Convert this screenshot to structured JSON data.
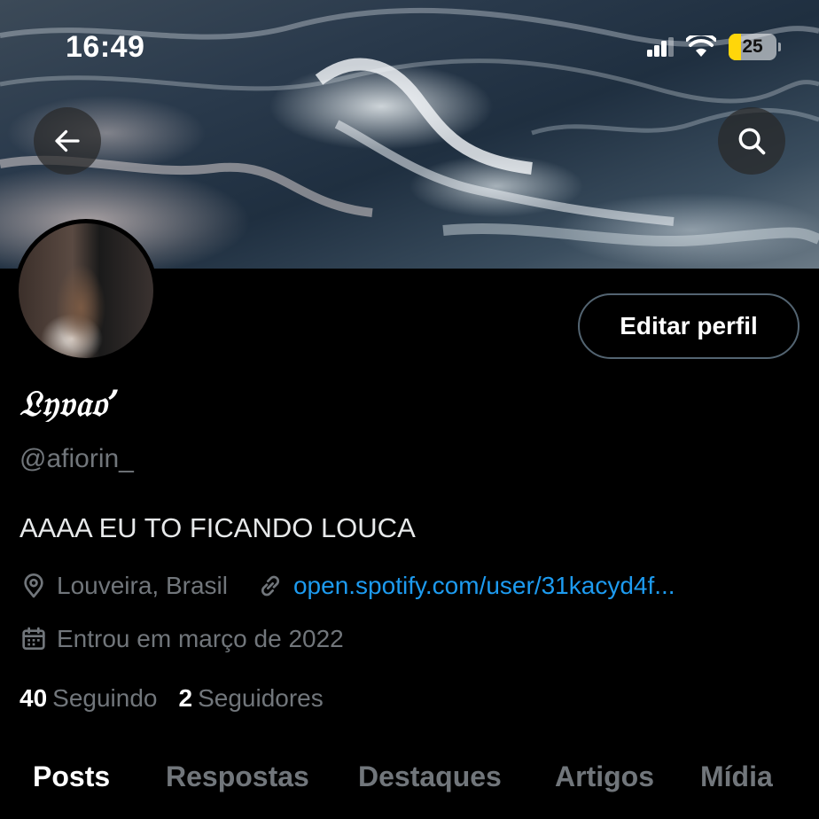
{
  "status_bar": {
    "time": "16:49",
    "battery_level": "25",
    "signal_icon": "cellular-signal-icon",
    "wifi_icon": "wifi-icon",
    "battery_color": "#ffd60a"
  },
  "header": {
    "back_icon": "arrow-left-icon",
    "search_icon": "search-icon"
  },
  "profile": {
    "display_name": "𝔏𝔶𝔳𝔞𝔬’",
    "handle": "@afiorin_",
    "bio": "AAAA EU TO FICANDO LOUCA",
    "location": "Louveira, Brasil",
    "website": "open.spotify.com/user/31kacyd4f...",
    "joined": "Entrou em março de 2022",
    "following_count": "40",
    "following_label": "Seguindo",
    "followers_count": "2",
    "followers_label": "Seguidores",
    "edit_button_label": "Editar perfil"
  },
  "tabs": [
    {
      "label": "Posts",
      "active": true
    },
    {
      "label": "Respostas",
      "active": false
    },
    {
      "label": "Destaques",
      "active": false
    },
    {
      "label": "Artigos",
      "active": false
    },
    {
      "label": "Mídia",
      "active": false
    }
  ],
  "colors": {
    "background": "#000000",
    "link": "#1d9bf0",
    "secondary_text": "#71767b",
    "primary_text": "#e7e9ea"
  }
}
